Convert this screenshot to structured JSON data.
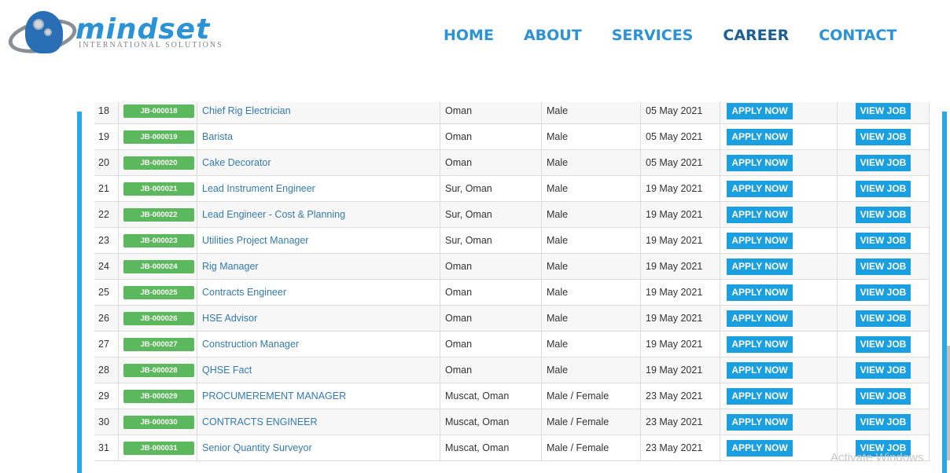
{
  "logo": {
    "name": "mindset",
    "tagline": "INTERNATIONAL SOLUTIONS"
  },
  "nav": [
    {
      "label": "HOME"
    },
    {
      "label": "ABOUT"
    },
    {
      "label": "SERVICES"
    },
    {
      "label": "CAREER"
    },
    {
      "label": "CONTACT"
    }
  ],
  "jobs": [
    {
      "no": "18",
      "code": "JB-000018",
      "title": "Chief Rig Electrician",
      "location": "Oman",
      "gender": "Male",
      "date": "05 May 2021",
      "apply": "APPLY NOW",
      "view": "VIEW JOB"
    },
    {
      "no": "19",
      "code": "JB-000019",
      "title": "Barista",
      "location": "Oman",
      "gender": "Male",
      "date": "05 May 2021",
      "apply": "APPLY NOW",
      "view": "VIEW JOB"
    },
    {
      "no": "20",
      "code": "JB-000020",
      "title": "Cake Decorator",
      "location": "Oman",
      "gender": "Male",
      "date": "05 May 2021",
      "apply": "APPLY NOW",
      "view": "VIEW JOB"
    },
    {
      "no": "21",
      "code": "JB-000021",
      "title": "Lead Instrument Engineer",
      "location": "Sur, Oman",
      "gender": "Male",
      "date": "19 May 2021",
      "apply": "APPLY NOW",
      "view": "VIEW JOB"
    },
    {
      "no": "22",
      "code": "JB-000022",
      "title": "Lead Engineer - Cost & Planning",
      "location": "Sur, Oman",
      "gender": "Male",
      "date": "19 May 2021",
      "apply": "APPLY NOW",
      "view": "VIEW JOB"
    },
    {
      "no": "23",
      "code": "JB-000023",
      "title": "Utilities Project Manager",
      "location": "Sur, Oman",
      "gender": "Male",
      "date": "19 May 2021",
      "apply": "APPLY NOW",
      "view": "VIEW JOB"
    },
    {
      "no": "24",
      "code": "JB-000024",
      "title": "Rig Manager",
      "location": "Oman",
      "gender": "Male",
      "date": "19 May 2021",
      "apply": "APPLY NOW",
      "view": "VIEW JOB"
    },
    {
      "no": "25",
      "code": "JB-000025",
      "title": "Contracts Engineer",
      "location": "Oman",
      "gender": "Male",
      "date": "19 May 2021",
      "apply": "APPLY NOW",
      "view": "VIEW JOB"
    },
    {
      "no": "26",
      "code": "JB-000026",
      "title": "HSE Advisor",
      "location": "Oman",
      "gender": "Male",
      "date": "19 May 2021",
      "apply": "APPLY NOW",
      "view": "VIEW JOB"
    },
    {
      "no": "27",
      "code": "JB-000027",
      "title": "Construction Manager",
      "location": "Oman",
      "gender": "Male",
      "date": "19 May 2021",
      "apply": "APPLY NOW",
      "view": "VIEW JOB"
    },
    {
      "no": "28",
      "code": "JB-000028",
      "title": "QHSE Fact",
      "location": "Oman",
      "gender": "Male",
      "date": "19 May 2021",
      "apply": "APPLY NOW",
      "view": "VIEW JOB"
    },
    {
      "no": "29",
      "code": "JB-000029",
      "title": "PROCUMEREMENT MANAGER",
      "location": "Muscat, Oman",
      "gender": "Male / Female",
      "date": "23 May 2021",
      "apply": "APPLY NOW",
      "view": "VIEW JOB"
    },
    {
      "no": "30",
      "code": "JB-000030",
      "title": "CONTRACTS ENGINEER",
      "location": "Muscat, Oman",
      "gender": "Male / Female",
      "date": "23 May 2021",
      "apply": "APPLY NOW",
      "view": "VIEW JOB"
    },
    {
      "no": "31",
      "code": "JB-000031",
      "title": "Senior Quantity Surveyor",
      "location": "Muscat, Oman",
      "gender": "Male / Female",
      "date": "23 May 2021",
      "apply": "APPLY NOW",
      "view": "VIEW JOB"
    }
  ],
  "watermark": "Activate Windows",
  "colors": {
    "accent": "#29a9e6",
    "nav": "#2a93d8",
    "badge": "#5cb85c",
    "button": "#1a9fe0",
    "link": "#337ab7"
  }
}
